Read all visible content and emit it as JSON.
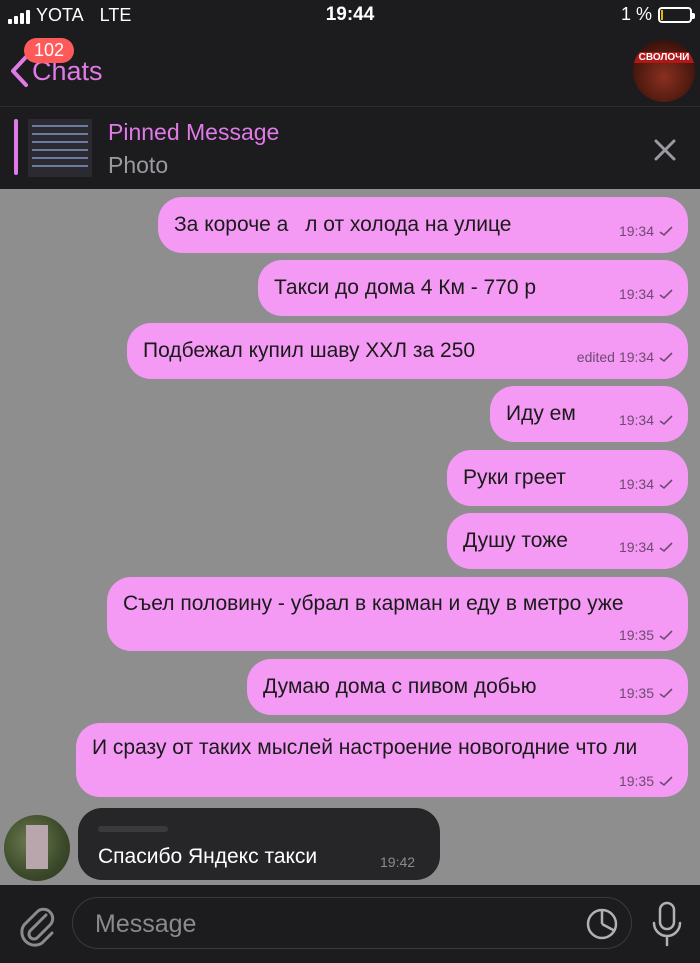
{
  "status_bar": {
    "carrier": "YOTA",
    "network": "LTE",
    "time": "19:44",
    "battery_percent": "1 %",
    "battery_level": 0.01
  },
  "navbar": {
    "back_label": "Chats",
    "unread_badge": "102",
    "avatar_caption": "СВОЛОЧИ"
  },
  "pinned": {
    "title": "Pinned Message",
    "subtitle": "Photo"
  },
  "messages": [
    {
      "text": "За короче а    л от холода на улице",
      "time": "19:34",
      "edited": ""
    },
    {
      "text": "Такси до дома 4 Км - 770 р",
      "time": "19:34",
      "edited": ""
    },
    {
      "text": "Подбежал купил шаву ХХЛ за 250",
      "time": "19:34",
      "edited": "edited"
    },
    {
      "text": "Иду ем",
      "time": "19:34",
      "edited": ""
    },
    {
      "text": "Руки греет",
      "time": "19:34",
      "edited": ""
    },
    {
      "text": "Душу тоже",
      "time": "19:34",
      "edited": ""
    },
    {
      "text": "Съел половину - убрал в карман и еду в метро уже",
      "time": "19:35",
      "edited": ""
    },
    {
      "text": "Думаю дома с пивом добью",
      "time": "19:35",
      "edited": ""
    },
    {
      "text": "И сразу от таких мыслей настроение новогодние что ли",
      "time": "19:35",
      "edited": ""
    }
  ],
  "incoming": {
    "text": "Спасибо Яндекс такси",
    "time": "19:42"
  },
  "input": {
    "placeholder": "Message"
  },
  "colors": {
    "accent": "#e07ae6",
    "bubble": "#f49af4",
    "chat_bg": "#8e8e8e",
    "bar_bg": "#1c1c1e"
  },
  "icons": [
    "signal-icon",
    "battery-icon",
    "back-chevron-icon",
    "close-icon",
    "read-check-icon",
    "attach-icon",
    "sticker-icon",
    "mic-icon"
  ]
}
